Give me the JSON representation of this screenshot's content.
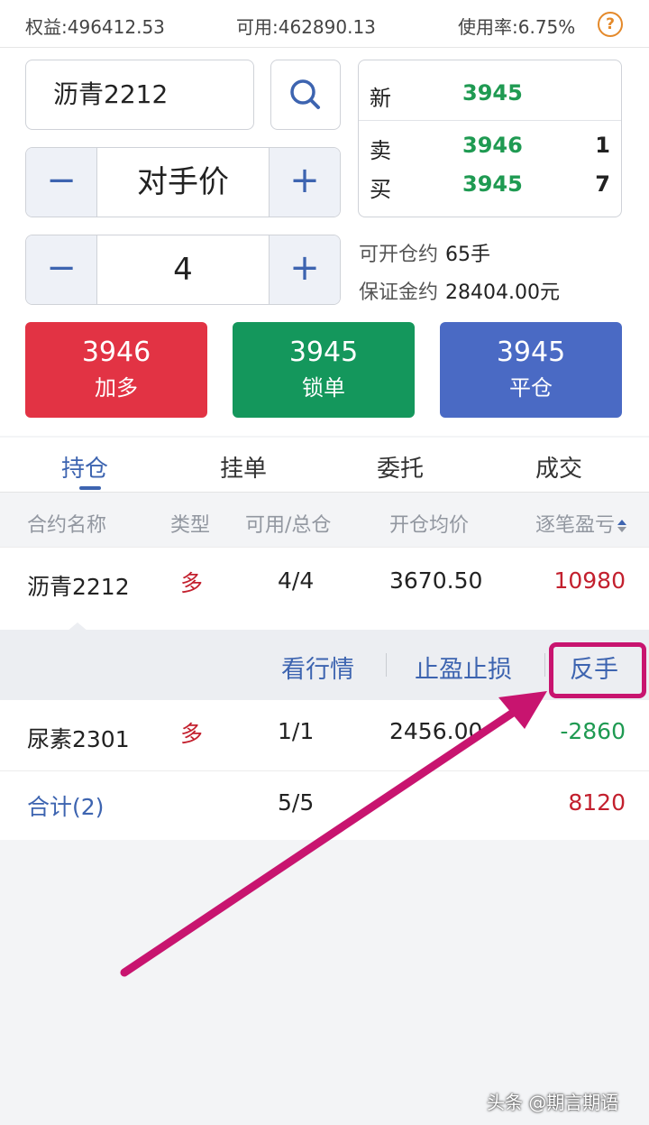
{
  "account": {
    "equity_label": "权益:",
    "equity_value": "496412.53",
    "available_label": "可用:",
    "available_value": "462890.13",
    "usage_label": "使用率:",
    "usage_value": "6.75%",
    "help_glyph": "?"
  },
  "order": {
    "symbol": "沥青2212",
    "price_mode": "对手价",
    "quantity": "4",
    "minus_glyph": "−",
    "plus_glyph": "+"
  },
  "quote": {
    "last_label": "新",
    "last_value": "3945",
    "ask_label": "卖",
    "ask_price": "3946",
    "ask_volume": "1",
    "bid_label": "买",
    "bid_price": "3945",
    "bid_volume": "7"
  },
  "capacity": {
    "openable_label": "可开仓约",
    "openable_value": "65手",
    "margin_label": "保证金约",
    "margin_value": "28404.00元"
  },
  "buttons": {
    "buy": {
      "price": "3946",
      "action": "加多",
      "color": "#e23344"
    },
    "lock": {
      "price": "3945",
      "action": "锁单",
      "color": "#14975c"
    },
    "close": {
      "price": "3945",
      "action": "平仓",
      "color": "#4a6ac4"
    }
  },
  "tabs": [
    "持仓",
    "挂单",
    "委托",
    "成交"
  ],
  "table": {
    "headers": [
      "合约名称",
      "类型",
      "可用/总仓",
      "开仓均价",
      "逐笔盈亏"
    ],
    "rows": [
      {
        "name": "沥青2212",
        "type": "多",
        "qty": "4/4",
        "avg": "3670.50",
        "pnl": "10980"
      },
      {
        "name": "尿素2301",
        "type": "多",
        "qty": "1/1",
        "avg": "2456.00",
        "pnl": "-2860"
      }
    ],
    "total": {
      "label": "合计(2)",
      "qty": "5/5",
      "pnl": "8120"
    }
  },
  "row_actions": [
    "看行情",
    "止盈止损",
    "反手"
  ],
  "colors": {
    "accent": "#3d64b0",
    "profit": "#c3202e",
    "loss": "#1f9a52",
    "annotation": "#c8146f"
  },
  "watermark": "头条 @期言期语"
}
